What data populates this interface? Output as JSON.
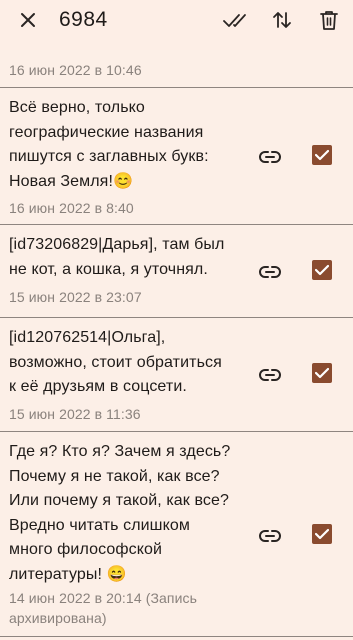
{
  "toolbar": {
    "title": "6984",
    "close_icon": "close-icon",
    "mark_all_icon": "double-check-icon",
    "sort_icon": "sort-icon",
    "delete_icon": "trash-icon"
  },
  "colors": {
    "background": "#fdeee6",
    "checkbox": "#8a4b2f",
    "date_text": "#8a827d",
    "divider": "#8e8580"
  },
  "items": [
    {
      "date": "16 июн 2022 в 10:46"
    },
    {
      "text": "Всё верно, только\nгеографические названия\nпишутся с заглавных букв:\nНовая Земля!😊",
      "date": "16 июн 2022 в 8:40",
      "checked": true
    },
    {
      "text": "[id73206829|Дарья], там был\nне кот, а кошка, я уточнял.",
      "date": "15 июн 2022 в 23:07",
      "checked": true
    },
    {
      "text": "[id120762514|Ольга],\nвозможно, стоит обратиться\nк её друзьям в соцсети.",
      "date": "15 июн 2022 в 11:36",
      "checked": true
    },
    {
      "text": "Где я? Кто я? Зачем я здесь?\nПочему я не такой, как все?\nИли почему я такой, как все?\nВредно читать слишком\nмного философской\nлитературы! 😄",
      "date": "14 июн 2022 в 20:14 (Запись\nархивирована)",
      "checked": true
    }
  ]
}
